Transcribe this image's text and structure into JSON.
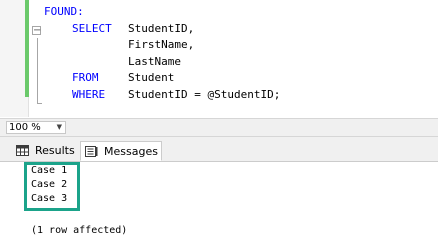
{
  "editor": {
    "label": "FOUND:",
    "fold_symbol": "−",
    "lines": [
      {
        "keyword": "SELECT",
        "text": "StudentID,"
      },
      {
        "keyword": "",
        "text": "FirstName,"
      },
      {
        "keyword": "",
        "text": "LastName"
      },
      {
        "keyword": "FROM",
        "text": "Student"
      },
      {
        "keyword": "WHERE",
        "text": "StudentID = @StudentID;"
      }
    ],
    "colors": {
      "keyword": "#0000ff",
      "change_bar": "#6ac96a"
    }
  },
  "zoom": {
    "value": "100 %"
  },
  "tabs": [
    {
      "label": "Results",
      "icon": "grid-icon"
    },
    {
      "label": "Messages",
      "icon": "message-icon",
      "active": true
    }
  ],
  "messages": {
    "lines": [
      "Case 1",
      "Case 2",
      "Case 3"
    ],
    "affected": "(1 row affected)",
    "highlight_color": "#1ba38a"
  }
}
